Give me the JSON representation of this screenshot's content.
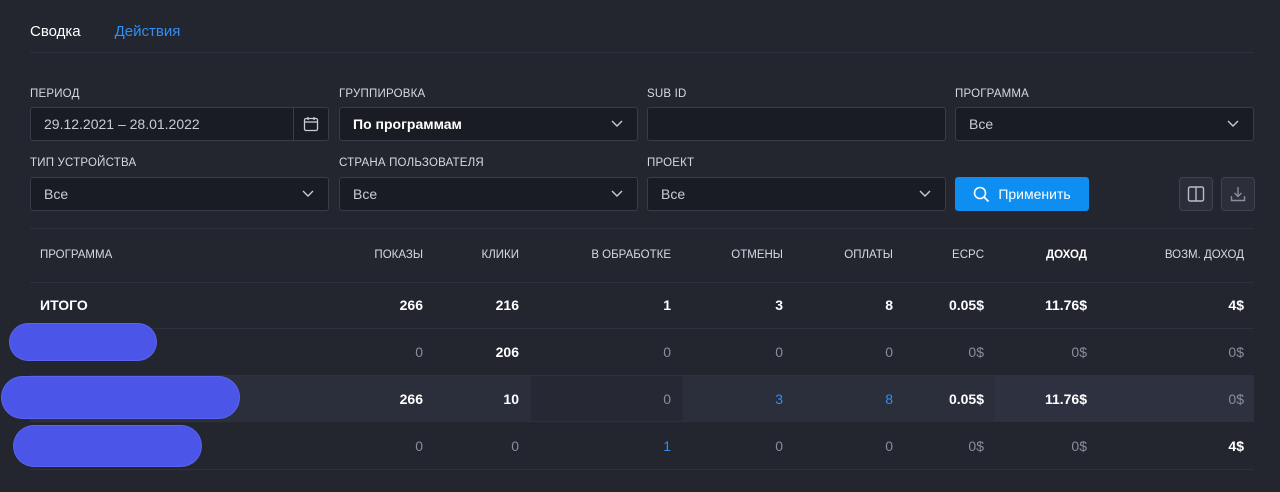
{
  "tabs": [
    {
      "label": "Сводка",
      "active": true
    },
    {
      "label": "Действия",
      "active": false
    }
  ],
  "filters": {
    "period": {
      "label": "ПЕРИОД",
      "value": "29.12.2021 – 28.01.2022"
    },
    "grouping": {
      "label": "ГРУППИРОВКА",
      "value": "По программам"
    },
    "subid": {
      "label": "SUB ID",
      "value": ""
    },
    "program": {
      "label": "ПРОГРАММА",
      "value": "Все"
    },
    "device": {
      "label": "ТИП УСТРОЙСТВА",
      "value": "Все"
    },
    "country": {
      "label": "СТРАНА ПОЛЬЗОВАТЕЛЯ",
      "value": "Все"
    },
    "project": {
      "label": "ПРОЕКТ",
      "value": "Все"
    }
  },
  "apply_label": "Применить",
  "table": {
    "headers": {
      "program": "ПРОГРАММА",
      "shows": "ПОКАЗЫ",
      "clicks": "КЛИКИ",
      "processing": "В ОБРАБОТКЕ",
      "cancels": "ОТМЕНЫ",
      "payments": "ОПЛАТЫ",
      "ecpc": "ECPC",
      "income": "ДОХОД",
      "possible_income": "ВОЗМ. ДОХОД"
    },
    "total": {
      "label": "ИТОГО",
      "shows": "266",
      "clicks": "216",
      "processing": "1",
      "cancels": "3",
      "payments": "8",
      "ecpc": "0.05$",
      "income": "11.76$",
      "possible_income": "4$"
    },
    "rows": [
      {
        "shows": "0",
        "clicks": "206",
        "processing": "0",
        "cancels": "0",
        "payments": "0",
        "ecpc": "0$",
        "income": "0$",
        "possible_income": "0$"
      },
      {
        "shows": "266",
        "clicks": "10",
        "processing": "0",
        "cancels": "3",
        "payments": "8",
        "ecpc": "0.05$",
        "income": "11.76$",
        "possible_income": "0$"
      },
      {
        "shows": "0",
        "clicks": "0",
        "processing": "1",
        "cancels": "0",
        "payments": "0",
        "ecpc": "0$",
        "income": "0$",
        "possible_income": "4$"
      }
    ]
  },
  "colors": {
    "accent": "#0e8ef0",
    "link": "#2f8ff2",
    "background": "#23252f",
    "redaction": "#4b56e8"
  },
  "icons": [
    "calendar-icon",
    "chevron-down-icon",
    "search-icon",
    "columns-icon",
    "download-icon"
  ]
}
